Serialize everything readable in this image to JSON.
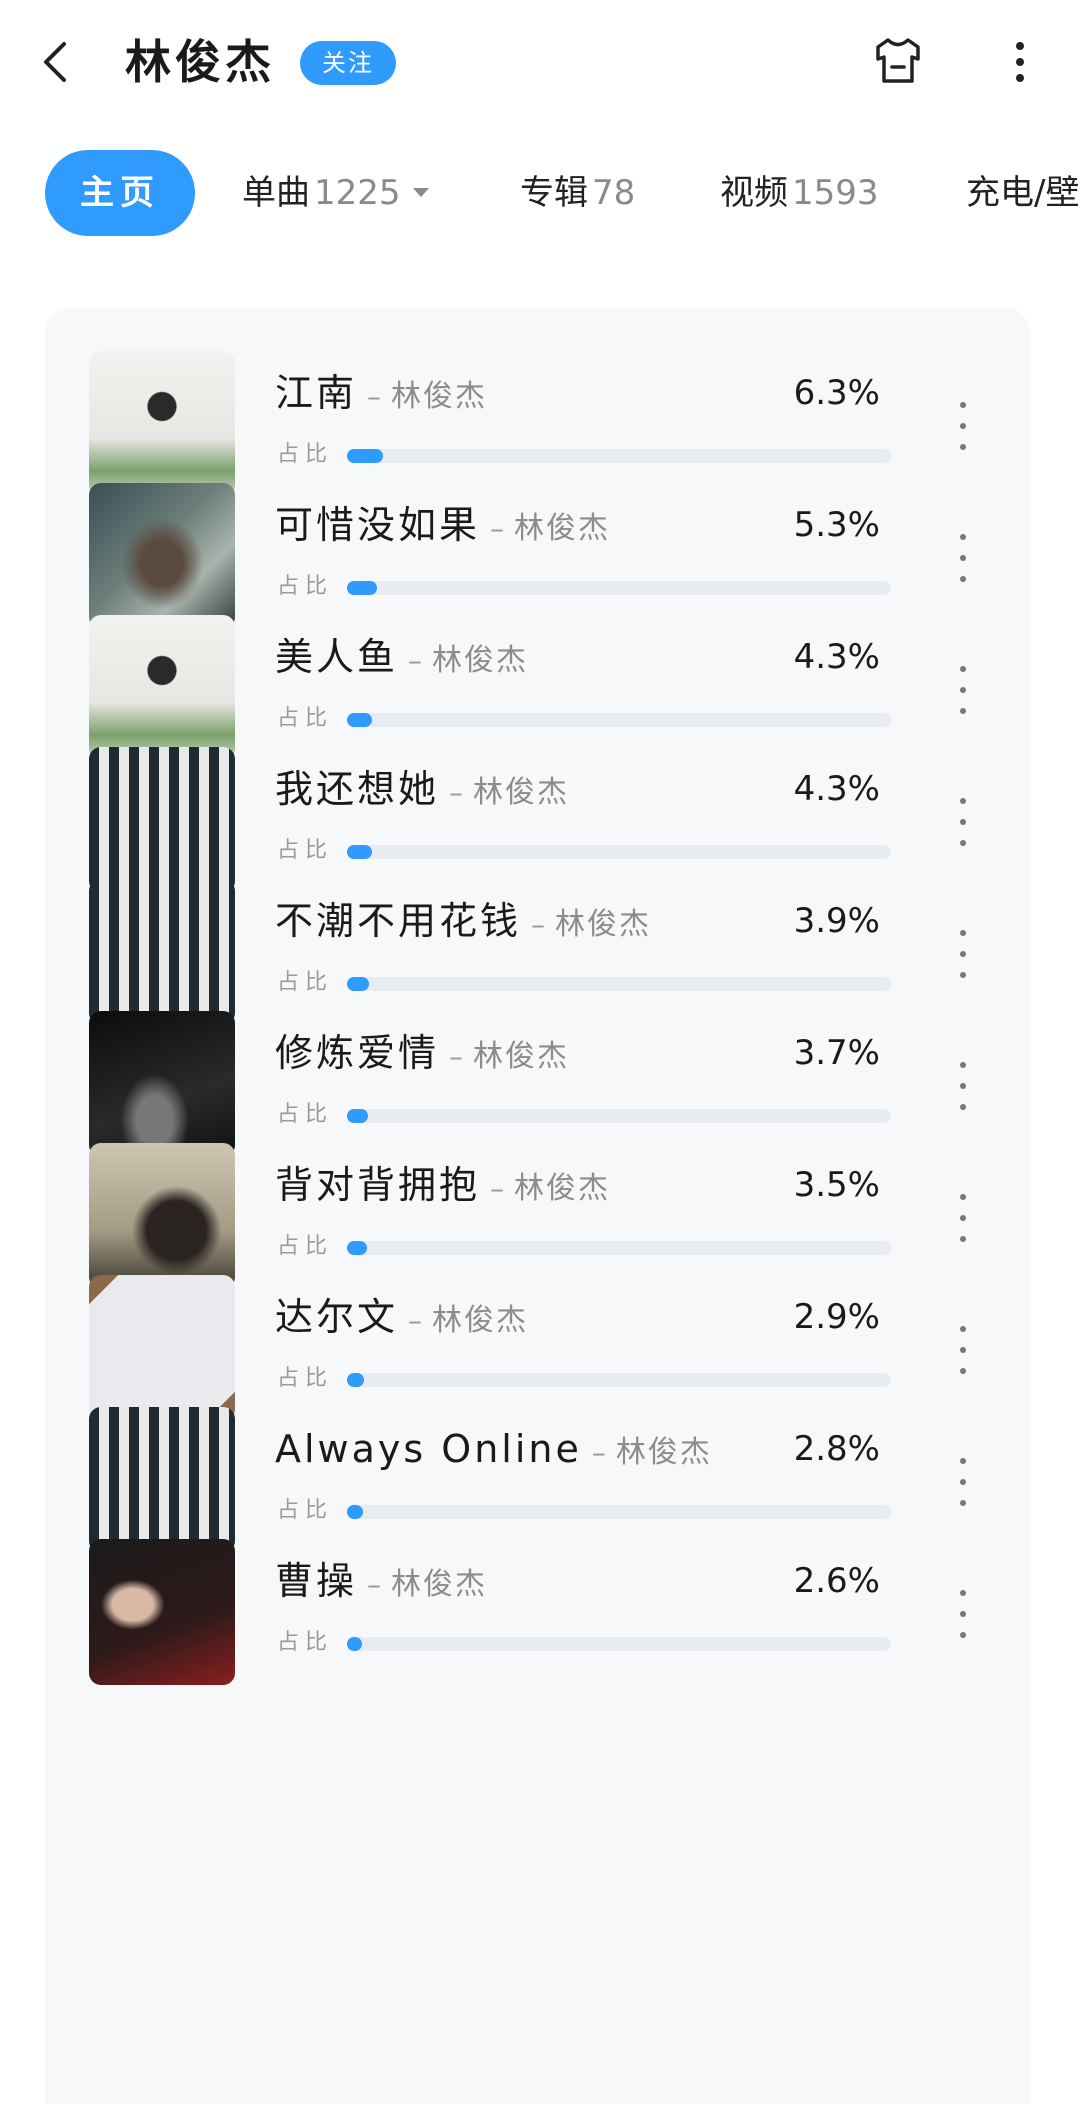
{
  "header": {
    "title": "林俊杰",
    "follow_label": "关注",
    "back_icon": "chevron-left-icon",
    "theme_icon": "shirt-icon",
    "more_icon": "more-vertical-icon"
  },
  "tabs": [
    {
      "label": "主页",
      "count": "",
      "active": true
    },
    {
      "label": "单曲",
      "count": "1225",
      "dropdown": true
    },
    {
      "label": "专辑",
      "count": "78"
    },
    {
      "label": "视频",
      "count": "1593"
    },
    {
      "label": "充电/壁",
      "count": ""
    }
  ],
  "share_label": "占比",
  "colors": {
    "accent": "#2f9bff",
    "track": "#e8ebf2",
    "card_bg": "#f7f8fa"
  },
  "songs": [
    {
      "name": "江南",
      "artist": "林俊杰",
      "percent": "6.3%",
      "share": 0.063,
      "cover": "cover-a"
    },
    {
      "name": "可惜没如果",
      "artist": "林俊杰",
      "percent": "5.3%",
      "share": 0.053,
      "cover": "cover-b"
    },
    {
      "name": "美人鱼",
      "artist": "林俊杰",
      "percent": "4.3%",
      "share": 0.043,
      "cover": "cover-a"
    },
    {
      "name": "我还想她",
      "artist": "林俊杰",
      "percent": "4.3%",
      "share": 0.043,
      "cover": "cover-c"
    },
    {
      "name": "不潮不用花钱",
      "artist": "林俊杰",
      "percent": "3.9%",
      "share": 0.039,
      "cover": "cover-c"
    },
    {
      "name": "修炼爱情",
      "artist": "林俊杰",
      "percent": "3.7%",
      "share": 0.037,
      "cover": "cover-d"
    },
    {
      "name": "背对背拥抱",
      "artist": "林俊杰",
      "percent": "3.5%",
      "share": 0.035,
      "cover": "cover-e"
    },
    {
      "name": "达尔文",
      "artist": "林俊杰",
      "percent": "2.9%",
      "share": 0.029,
      "cover": "cover-f"
    },
    {
      "name": "Always Online",
      "artist": "林俊杰",
      "percent": "2.8%",
      "share": 0.028,
      "cover": "cover-c"
    },
    {
      "name": "曹操",
      "artist": "林俊杰",
      "percent": "2.6%",
      "share": 0.026,
      "cover": "cover-g"
    }
  ]
}
